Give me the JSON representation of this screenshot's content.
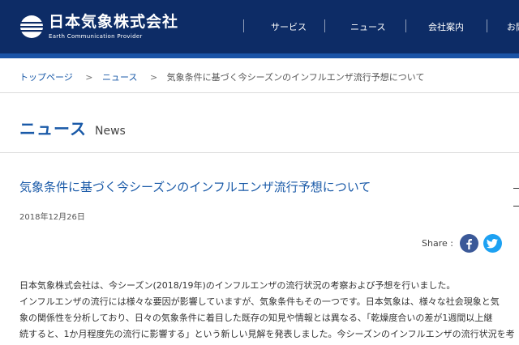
{
  "header": {
    "brand_name": "日本気象株式会社",
    "brand_tagline": "Earth Communication Provider",
    "nav": [
      {
        "label": "サービス"
      },
      {
        "label": "ニュース"
      },
      {
        "label": "会社案内"
      },
      {
        "label": "お問"
      }
    ]
  },
  "breadcrumb": {
    "home": "トップページ",
    "separator": ">",
    "news": "ニュース",
    "current": "気象条件に基づく今シーズンのインフルエンザ流行予想について"
  },
  "section": {
    "title_jp": "ニュース",
    "title_en": "News"
  },
  "article": {
    "title": "気象条件に基づく今シーズンのインフルエンザ流行予想について",
    "date": "2018年12月26日",
    "share_label": "Share :",
    "body_lines": [
      "日本気象株式会社は、今シーズン(2018/19年)のインフルエンザの流行状況の考察および予想を行いました。",
      "インフルエンザの流行には様々な要因が影響していますが、気象条件もその一つです。日本気象は、様々な社会現象と気",
      "象の関係性を分析しており、日々の気象条件に着目した既存の知見や情報とは異なる、「乾燥度合いの差が1週間以上継",
      "続すると、1か月程度先の流行に影響する」という新しい見解を発表しました。今シーズンのインフルエンザの流行状況を考"
    ]
  },
  "colors": {
    "header_bg": "#0d2c66",
    "accent": "#1a5aa8",
    "facebook": "#3b5998",
    "twitter": "#1da1f2"
  },
  "icons": {
    "logo": "earth-logo-icon",
    "facebook": "facebook-icon",
    "twitter": "twitter-icon"
  }
}
